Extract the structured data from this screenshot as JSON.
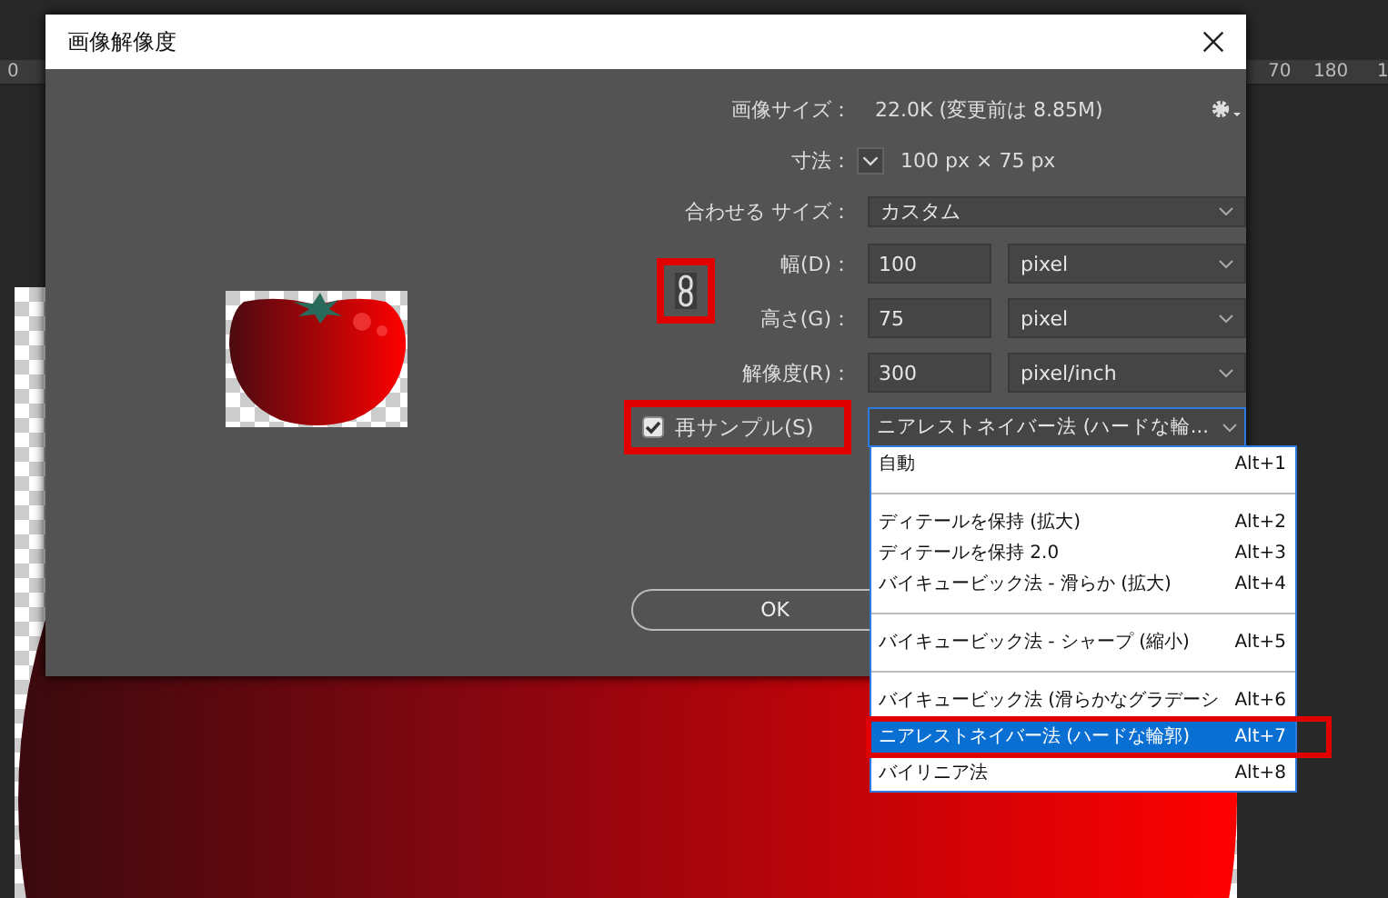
{
  "ruler": {
    "labels": [
      "0",
      "70",
      "180",
      "1"
    ]
  },
  "dialog": {
    "title": "画像解像度",
    "image_size": {
      "label": "画像サイズ：",
      "value": "22.0K (変更前は 8.85M)"
    },
    "dimensions": {
      "label": "寸法：",
      "value": "100 px × 75 px"
    },
    "fit_to": {
      "label": "合わせる サイズ：",
      "value": "カスタム"
    },
    "fields": [
      {
        "label": "幅(D)：",
        "value": "100",
        "unit": "pixel"
      },
      {
        "label": "高さ(G)：",
        "value": "75",
        "unit": "pixel"
      },
      {
        "label": "解像度(R)：",
        "value": "300",
        "unit": "pixel/inch"
      }
    ],
    "constrain_link": {
      "highlighted": true
    },
    "resample": {
      "label": "再サンプル(S)",
      "checked": true,
      "highlighted": true,
      "method": "ニアレストネイバー法 (ハードな輪..."
    },
    "ok_button": "OK"
  },
  "dropdown": {
    "items": [
      {
        "label": "自動",
        "shortcut": "Alt+1",
        "selected": false,
        "highlighted": false,
        "separator_after": true
      },
      {
        "label": "ディテールを保持 (拡大)",
        "shortcut": "Alt+2",
        "selected": false,
        "highlighted": false,
        "separator_after": false
      },
      {
        "label": "ディテールを保持 2.0",
        "shortcut": "Alt+3",
        "selected": false,
        "highlighted": false,
        "separator_after": false
      },
      {
        "label": "バイキュービック法 - 滑らか (拡大)",
        "shortcut": "Alt+4",
        "selected": false,
        "highlighted": false,
        "separator_after": true
      },
      {
        "label": "バイキュービック法 - シャープ (縮小)",
        "shortcut": "Alt+5",
        "selected": false,
        "highlighted": false,
        "separator_after": true
      },
      {
        "label": "バイキュービック法 (滑らかなグラデーシ",
        "shortcut": "Alt+6",
        "selected": false,
        "highlighted": false,
        "separator_after": false
      },
      {
        "label": "ニアレストネイバー法 (ハードな輪郭)",
        "shortcut": "Alt+7",
        "selected": true,
        "highlighted": true,
        "separator_after": false
      },
      {
        "label": "バイリニア法",
        "shortcut": "Alt+8",
        "selected": false,
        "highlighted": false,
        "separator_after": false
      }
    ]
  }
}
